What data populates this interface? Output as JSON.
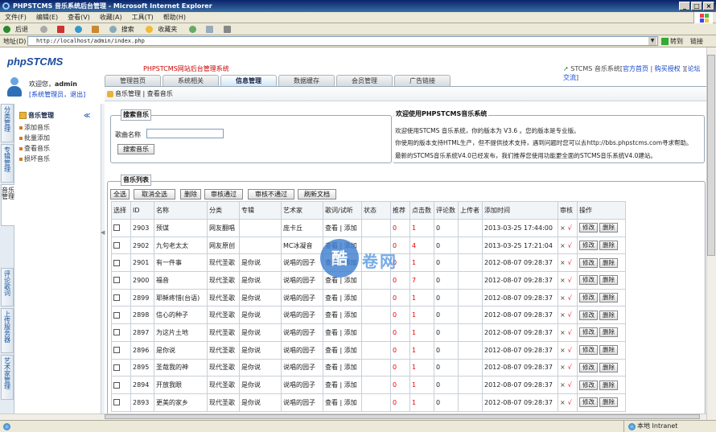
{
  "window": {
    "title": "PHPSTCMS 音乐系统后台管理 - Microsoft Internet Explorer"
  },
  "menubar": [
    "文件(F)",
    "编辑(E)",
    "查看(V)",
    "收藏(A)",
    "工具(T)",
    "帮助(H)"
  ],
  "toolbar": {
    "back": "后退",
    "search": "搜索",
    "favorites": "收藏夹"
  },
  "address": {
    "label": "地址(D)",
    "url": "http://localhost/admin/index.php",
    "go": "转到",
    "links": "链接"
  },
  "status": {
    "zone": "本地 Intranet"
  },
  "header": {
    "logo": "phpSTCMS",
    "system_name": "PHPSTCMS网站后台管理系统",
    "links_prefix": "STCMS 音乐系统[",
    "links": [
      "官方首页",
      "购买授权",
      "论坛交流"
    ]
  },
  "user": {
    "welcome": "欢迎您，",
    "name": "admin",
    "role": "[系统管理员，退出]"
  },
  "nav_tabs": [
    "管理首页",
    "系统相关",
    "信息管理",
    "数据缓存",
    "会员管理",
    "广告链接"
  ],
  "breadcrumb": "音乐管理 | 查看音乐",
  "left_tabs": [
    "分类管理",
    "专辑管理",
    "音乐管理",
    "评论歌词",
    "上传服务器",
    "艺术家管理"
  ],
  "left_menu": {
    "title": "音乐管理",
    "collapse": "≪",
    "items": [
      "添加音乐",
      "批量添加",
      "查看音乐",
      "损坏音乐"
    ]
  },
  "search_panel": {
    "legend": "搜索音乐",
    "label": "歌曲名称",
    "input_value": "",
    "button": "搜索音乐"
  },
  "welcome_panel": {
    "legend": "欢迎使用PHPSTCMS音乐系统",
    "lines": [
      "欢迎使用STCMS 音乐系统，你的版本为 V3.6 。您的版本是专业版。",
      "你使用的版本支持HTML生产，但不提供技术支持，遇到问题时您可以去http://bbs.phpstcms.com寻求帮助。",
      "最新的STCMS音乐系统V4.0已经发布，我们推荐您使用功能更全面的STCMS音乐系统V4.0建站。"
    ]
  },
  "list_panel": {
    "legend": "音乐列表",
    "buttons": [
      "全选",
      "取消全选",
      "删除",
      "审核通过",
      "审核不通过",
      "刷新文档"
    ],
    "columns": [
      "选择",
      "ID",
      "名称",
      "分类",
      "专辑",
      "艺术家",
      "歌词/试听",
      "状态",
      "推荐",
      "点击数",
      "评论数",
      "上传者",
      "添加时间",
      "审核",
      "操作"
    ],
    "row_actions": {
      "view": "查看",
      "add": "添加",
      "edit": "修改",
      "delete": "删除",
      "reject": "×",
      "approve": "√"
    },
    "rows": [
      {
        "id": "2903",
        "name": "预谋",
        "category": "网友翻唱",
        "album": "",
        "artist": "庞卡丘",
        "recommend": "0",
        "clicks": "1",
        "comments": "0",
        "uploader": "",
        "time": "2013-03-25 17:44:00"
      },
      {
        "id": "2902",
        "name": "九句老太太",
        "category": "网友原创",
        "album": "",
        "artist": "MC冰凝音",
        "recommend": "0",
        "clicks": "4",
        "comments": "0",
        "uploader": "",
        "time": "2013-03-25 17:21:04"
      },
      {
        "id": "2901",
        "name": "有一件事",
        "category": "现代圣歌",
        "album": "是你说",
        "artist": "说唱的园子",
        "recommend": "0",
        "clicks": "1",
        "comments": "0",
        "uploader": "",
        "time": "2012-08-07 09:28:37"
      },
      {
        "id": "2900",
        "name": "福音",
        "category": "现代圣歌",
        "album": "是你说",
        "artist": "说唱的园子",
        "recommend": "0",
        "clicks": "7",
        "comments": "0",
        "uploader": "",
        "time": "2012-08-07 09:28:37"
      },
      {
        "id": "2899",
        "name": "耶稣疼惜(台语)",
        "category": "现代圣歌",
        "album": "是你说",
        "artist": "说唱的园子",
        "recommend": "0",
        "clicks": "1",
        "comments": "0",
        "uploader": "",
        "time": "2012-08-07 09:28:37"
      },
      {
        "id": "2898",
        "name": "信心的种子",
        "category": "现代圣歌",
        "album": "是你说",
        "artist": "说唱的园子",
        "recommend": "0",
        "clicks": "1",
        "comments": "0",
        "uploader": "",
        "time": "2012-08-07 09:28:37"
      },
      {
        "id": "2897",
        "name": "为这片土地",
        "category": "现代圣歌",
        "album": "是你说",
        "artist": "说唱的园子",
        "recommend": "0",
        "clicks": "1",
        "comments": "0",
        "uploader": "",
        "time": "2012-08-07 09:28:37"
      },
      {
        "id": "2896",
        "name": "是你说",
        "category": "现代圣歌",
        "album": "是你说",
        "artist": "说唱的园子",
        "recommend": "0",
        "clicks": "1",
        "comments": "0",
        "uploader": "",
        "time": "2012-08-07 09:28:37"
      },
      {
        "id": "2895",
        "name": "圣哉我的神",
        "category": "现代圣歌",
        "album": "是你说",
        "artist": "说唱的园子",
        "recommend": "0",
        "clicks": "1",
        "comments": "0",
        "uploader": "",
        "time": "2012-08-07 09:28:37"
      },
      {
        "id": "2894",
        "name": "开放我眼",
        "category": "现代圣歌",
        "album": "是你说",
        "artist": "说唱的园子",
        "recommend": "0",
        "clicks": "1",
        "comments": "0",
        "uploader": "",
        "time": "2012-08-07 09:28:37"
      },
      {
        "id": "2893",
        "name": "更美的家乡",
        "category": "现代圣歌",
        "album": "是你说",
        "artist": "说唱的园子",
        "recommend": "0",
        "clicks": "1",
        "comments": "0",
        "uploader": "",
        "time": "2012-08-07 09:28:37"
      }
    ]
  },
  "watermark": {
    "glyph": "酷",
    "text": "卷网"
  }
}
